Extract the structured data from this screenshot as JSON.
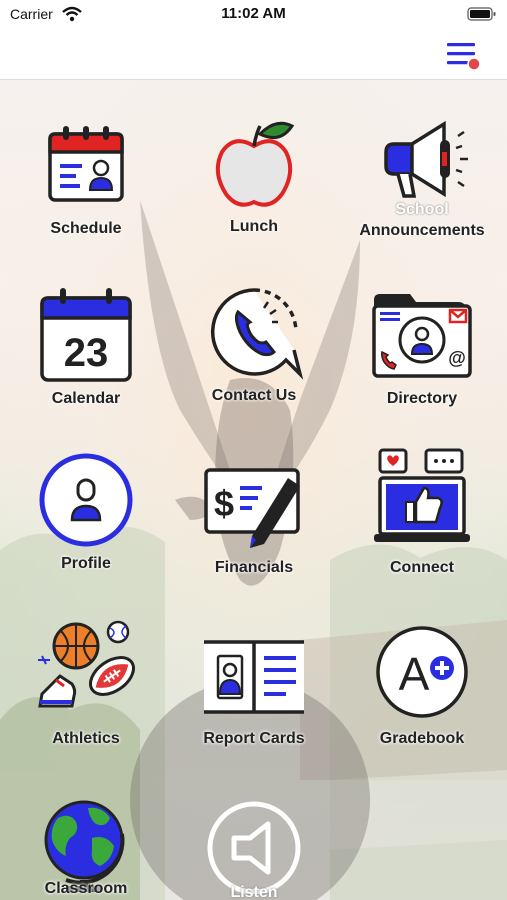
{
  "status_bar": {
    "carrier": "Carrier",
    "time": "11:02 AM"
  },
  "nav": {
    "menu_icon": "hamburger-menu-icon",
    "notification_dot_color": "#e34646"
  },
  "colors": {
    "primary_blue": "#2b2ee0",
    "accent_red": "#e02424",
    "outline": "#222222"
  },
  "tiles": [
    {
      "label": "Schedule",
      "icon": "calendar-schedule-icon"
    },
    {
      "label": "Lunch",
      "icon": "apple-icon"
    },
    {
      "label_line1": "School",
      "label_line2": "Announcements",
      "icon": "megaphone-icon"
    },
    {
      "label": "Calendar",
      "icon": "calendar-23-icon",
      "day": "23"
    },
    {
      "label": "Contact Us",
      "icon": "phone-bubble-icon"
    },
    {
      "label": "Directory",
      "icon": "directory-folder-icon"
    },
    {
      "label": "Profile",
      "icon": "profile-icon"
    },
    {
      "label": "Financials",
      "icon": "check-dollar-icon",
      "glyph": "$"
    },
    {
      "label": "Connect",
      "icon": "social-laptop-icon"
    },
    {
      "label": "Athletics",
      "icon": "sports-balls-icon"
    },
    {
      "label": "Report Cards",
      "icon": "report-card-icon"
    },
    {
      "label": "Gradebook",
      "icon": "grade-a-plus-icon",
      "grade": "A"
    },
    {
      "label": "Classroom",
      "icon": "globe-icon"
    },
    {
      "label": "Listen",
      "icon": "speaker-icon"
    }
  ]
}
